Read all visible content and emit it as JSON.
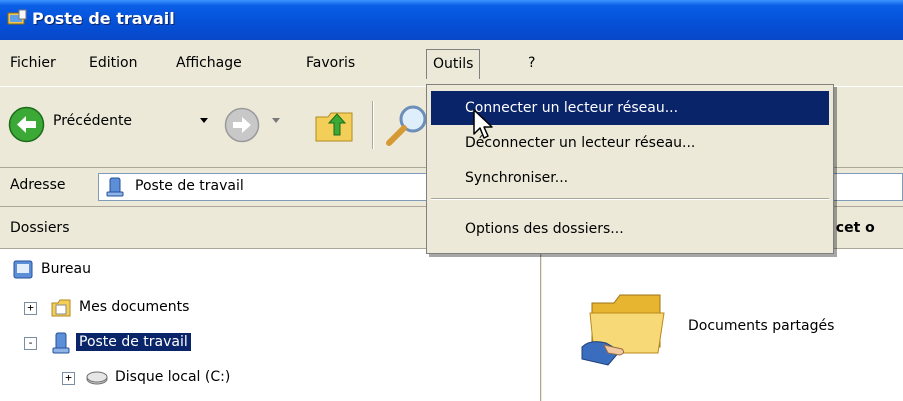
{
  "window": {
    "title": "Poste de travail"
  },
  "menubar": {
    "items": [
      "Fichier",
      "Edition",
      "Affichage",
      "Favoris",
      "Outils",
      "?"
    ],
    "open_item": "Outils"
  },
  "toolbar": {
    "back_label": "Précédente"
  },
  "address": {
    "label": "Adresse",
    "value": "Poste de travail"
  },
  "folders": {
    "header": "Dossiers",
    "tree": [
      {
        "label": "Bureau",
        "icon": "desktop-icon"
      },
      {
        "label": "Mes documents",
        "icon": "my-documents-icon",
        "expander": "+"
      },
      {
        "label": "Poste de travail",
        "icon": "my-computer-icon",
        "expander": "-",
        "selected": true
      },
      {
        "label": "Disque local (C:)",
        "icon": "hard-drive-icon",
        "expander": "+"
      }
    ]
  },
  "content": {
    "header_fragment": "r cet o",
    "items": [
      {
        "label": "Documents partagés",
        "icon": "shared-folder-icon"
      }
    ]
  },
  "tools_menu": {
    "items": [
      {
        "label": "Connecter un lecteur réseau...",
        "highlighted": true
      },
      {
        "label": "Déconnecter un lecteur réseau..."
      },
      {
        "label": "Synchroniser..."
      },
      {
        "label": "Options des dossiers..."
      }
    ]
  },
  "colors": {
    "title_bar": "#0a5ee6",
    "selection": "#0a246a",
    "chrome": "#ece9d8"
  }
}
